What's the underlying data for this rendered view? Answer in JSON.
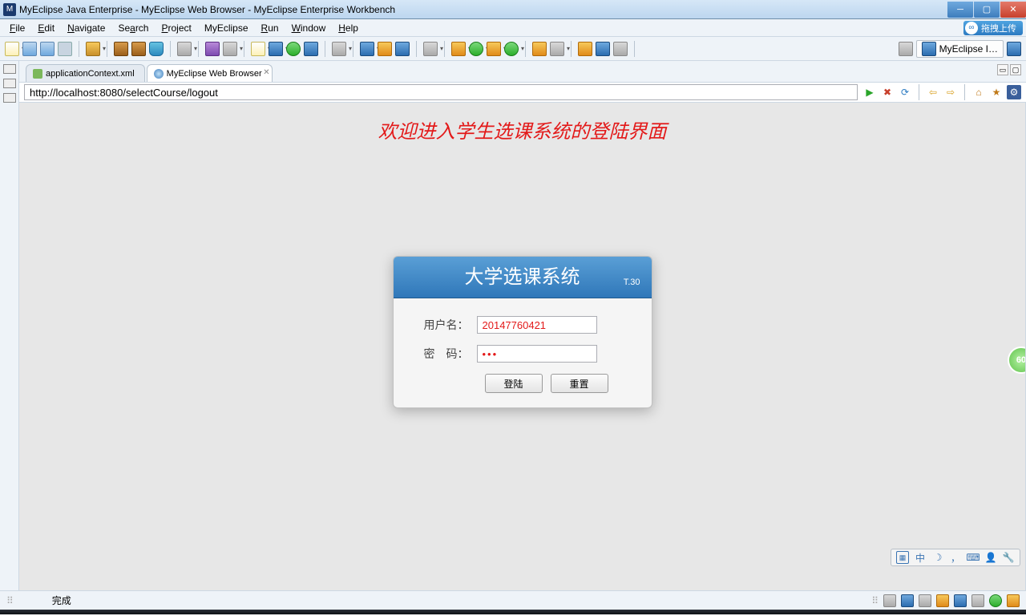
{
  "window": {
    "title": "MyEclipse Java Enterprise - MyEclipse Web Browser - MyEclipse Enterprise Workbench"
  },
  "menu": {
    "file": "File",
    "edit": "Edit",
    "navigate": "Navigate",
    "search": "Search",
    "project": "Project",
    "myeclipse": "MyEclipse",
    "run": "Run",
    "window": "Window",
    "help": "Help",
    "upload": "拖拽上传"
  },
  "perspective": {
    "label": "MyEclipse I…"
  },
  "tabs": {
    "context": "applicationContext.xml",
    "browser": "MyEclipse Web Browser"
  },
  "browser": {
    "url": "http://localhost:8080/selectCourse/logout"
  },
  "page": {
    "welcome": "欢迎进入学生选课系统的登陆界面",
    "panel_title": "大学选课系统",
    "panel_version": "T.30",
    "username_label": "用户名：",
    "password_label": "密　码：",
    "username_value": "20147760421",
    "password_value": "•••",
    "login_btn": "登陆",
    "reset_btn": "重置",
    "side_badge": "60"
  },
  "ime": {
    "zhong": "中",
    "moon": "☽",
    "comma": "，"
  },
  "status": {
    "done": "完成"
  }
}
